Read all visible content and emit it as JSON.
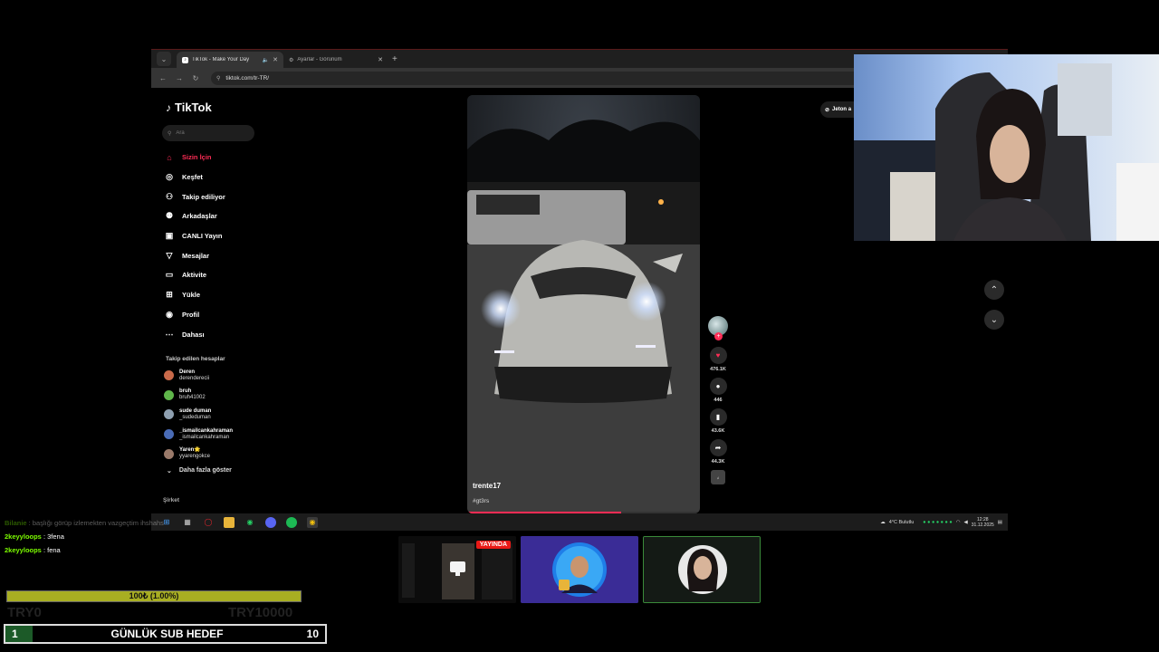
{
  "browser": {
    "tabs": [
      {
        "title": "TikTok - Make Your Day",
        "active": true
      },
      {
        "title": "Ayarlar - Görünüm",
        "active": false
      }
    ],
    "url": "tiktok.com/tr-TR/"
  },
  "tiktok": {
    "logo": "TikTok",
    "search_placeholder": "Ara",
    "nav": [
      {
        "label": "Sizin İçin",
        "icon": "home-icon",
        "active": true
      },
      {
        "label": "Keşfet",
        "icon": "compass-icon",
        "active": false
      },
      {
        "label": "Takip ediliyor",
        "icon": "following-icon",
        "active": false
      },
      {
        "label": "Arkadaşlar",
        "icon": "friends-icon",
        "active": false
      },
      {
        "label": "CANLI Yayın",
        "icon": "live-icon",
        "active": false
      },
      {
        "label": "Mesajlar",
        "icon": "messages-icon",
        "active": false
      },
      {
        "label": "Aktivite",
        "icon": "activity-icon",
        "active": false
      },
      {
        "label": "Yükle",
        "icon": "upload-icon",
        "active": false
      },
      {
        "label": "Profil",
        "icon": "profile-icon",
        "active": false
      },
      {
        "label": "Dahası",
        "icon": "more-icon",
        "active": false
      }
    ],
    "following_header": "Takip edilen hesaplar",
    "following": [
      {
        "name": "Deren",
        "handle": "derenderecii",
        "color": "#c96a4a"
      },
      {
        "name": "bruh",
        "handle": "bruh41002",
        "color": "#5fb64a"
      },
      {
        "name": "sude duman",
        "handle": "_sudeduman",
        "color": "#8fa0b0"
      },
      {
        "name": "_ismailcankahraman",
        "handle": "_ismailcankahraman",
        "color": "#4a6cb6"
      },
      {
        "name": "Yaren🌟",
        "handle": "yyarengokce",
        "color": "#9a7a6a"
      }
    ],
    "see_more": "Daha fazla göster",
    "company": "Şirket",
    "coin_button": "Jeton a",
    "video": {
      "username": "trente17",
      "hashtag": "#gt3rs",
      "progress": 0.66
    },
    "actions": {
      "likes": "476.1K",
      "comments": "446",
      "saves": "43.6K",
      "shares": "44.3K"
    }
  },
  "taskbar": {
    "weather": "4°C  Bulutlu",
    "time": "12:28",
    "date": "31.12.2025"
  },
  "stream": {
    "chat": [
      {
        "user": "Bilanie",
        "text": "başlığı görüp izlemekten vazgeçtim ihshahs",
        "faded": true
      },
      {
        "user": "2keyyloops",
        "text": "3fena",
        "faded": false
      },
      {
        "user": "2keyyloops",
        "text": "fena",
        "faded": false
      }
    ],
    "goal_text": "100₺ (1.00%)",
    "goal_fraction": 0.01,
    "goal_min": "TRY0",
    "goal_max": "TRY10000",
    "sub_goal_current": "1",
    "sub_goal_label": "GÜNLÜK SUB HEDEF",
    "sub_goal_target": "10",
    "live_badge": "YAYINDA"
  }
}
